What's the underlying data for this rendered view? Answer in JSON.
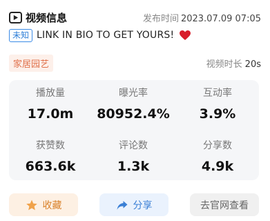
{
  "header": {
    "title": "视频信息",
    "publish_label": "发布时间",
    "publish_time": "2023.07.09 07:05"
  },
  "description": {
    "badge": "未知",
    "text": "LINK IN BIO TO GET YOURS!",
    "emoji_icon": "red-heart-icon"
  },
  "meta": {
    "category": "家居园艺",
    "duration_label": "视频时长",
    "duration_value": "20s"
  },
  "stats": [
    {
      "label": "播放量",
      "value": "17.0m"
    },
    {
      "label": "曝光率",
      "value": "80952.4%"
    },
    {
      "label": "互动率",
      "value": "3.9%"
    },
    {
      "label": "获赞数",
      "value": "663.6k"
    },
    {
      "label": "评论数",
      "value": "1.3k"
    },
    {
      "label": "分享数",
      "value": "4.9k"
    }
  ],
  "actions": {
    "favorite": "收藏",
    "share": "分享",
    "visit": "去官网查看"
  },
  "colors": {
    "accent_blue": "#3a7fd5",
    "accent_orange": "#d9822b",
    "category_text": "#e0704a"
  }
}
